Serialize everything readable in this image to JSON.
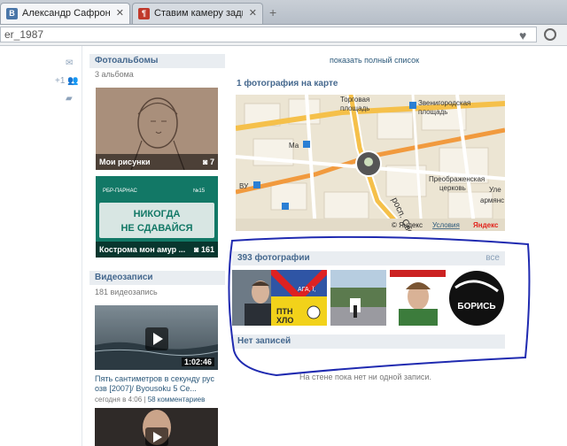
{
  "browser": {
    "tabs": [
      {
        "label": "Александр Сафронов",
        "favicon": "В",
        "favicon_color": "#4a76a8"
      },
      {
        "label": "Ставим камеру заднего в",
        "favicon": "¶",
        "favicon_color": "#c0392b"
      }
    ],
    "address": "er_1987"
  },
  "left_nav": {
    "friends_count": "+1"
  },
  "albums": {
    "title": "Фотоальбомы",
    "count": "3 альбома",
    "items": [
      {
        "name": "Мои рисунки",
        "count": "7"
      },
      {
        "name": "Кострома мон амур ...",
        "count": "161"
      }
    ]
  },
  "poster_text": {
    "brand": "РБР-ПАРНАС",
    "number": "№15",
    "line1": "НИКОГДА",
    "line2": "НЕ СДАВАЙСЯ"
  },
  "videos": {
    "title": "Видеозаписи",
    "count": "181 видеозапись",
    "items": [
      {
        "duration": "1:02:46",
        "title": "Пять сантиметров в секунду рус озв [2007]/ Byousoku 5 Ce...",
        "date": "сегодня в 4:06",
        "comments": "58 комментариев"
      }
    ]
  },
  "show_full_list": "показать полный список",
  "map": {
    "title": "1 фотография на карте",
    "labels": {
      "torg": "Торговая",
      "ploshchad1": "площадь",
      "zvenig": "Звенигородская",
      "ploshchad2": "площадь",
      "ma": "Ма",
      "vu": "ВУ",
      "preobr": "Преображенская",
      "church": "церковь",
      "ule": "Уле",
      "armyan": "армянс",
      "prosp": "росп. Свобо"
    },
    "copyright": "© Яндекс",
    "terms": "Условия",
    "logo": "Яндекс"
  },
  "photos": {
    "title": "393 фотографии",
    "all_link": "все",
    "thumb_texts": {
      "aga": "АГА, Ї,",
      "pth": "ПТН\nХЛО",
      "boris": "БОРИСЬ"
    }
  },
  "wall": {
    "title": "Нет записей",
    "empty": "На стене пока нет ни одной записи."
  }
}
